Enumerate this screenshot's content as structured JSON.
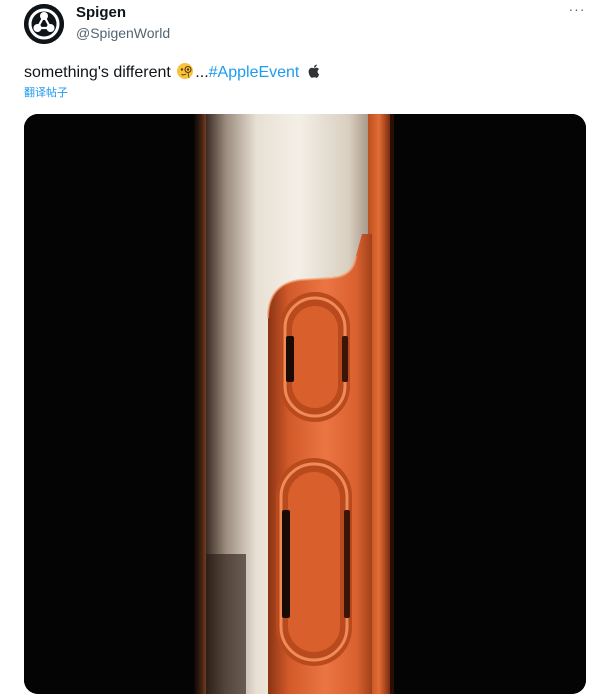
{
  "author": {
    "display_name": "Spigen",
    "handle": "@SpigenWorld",
    "avatar_icon": "spigen-logo-icon"
  },
  "more_menu": {
    "label": "···",
    "icon": "more-horizontal-icon"
  },
  "tweet": {
    "text_before": "something's different ",
    "emoji_icon": "monocle-face-emoji-icon",
    "ellipsis": "...",
    "hashtag": "#AppleEvent",
    "trailing_icon": "apple-logo-icon",
    "translate_label": "翻译帖子"
  },
  "media": {
    "type": "image",
    "subject": "phone-side-buttons-photo"
  },
  "colors": {
    "text": "#0f1419",
    "secondary": "#536471",
    "link": "#1d9bf0",
    "phone_orange": "#e2622f",
    "background": "#ffffff"
  }
}
